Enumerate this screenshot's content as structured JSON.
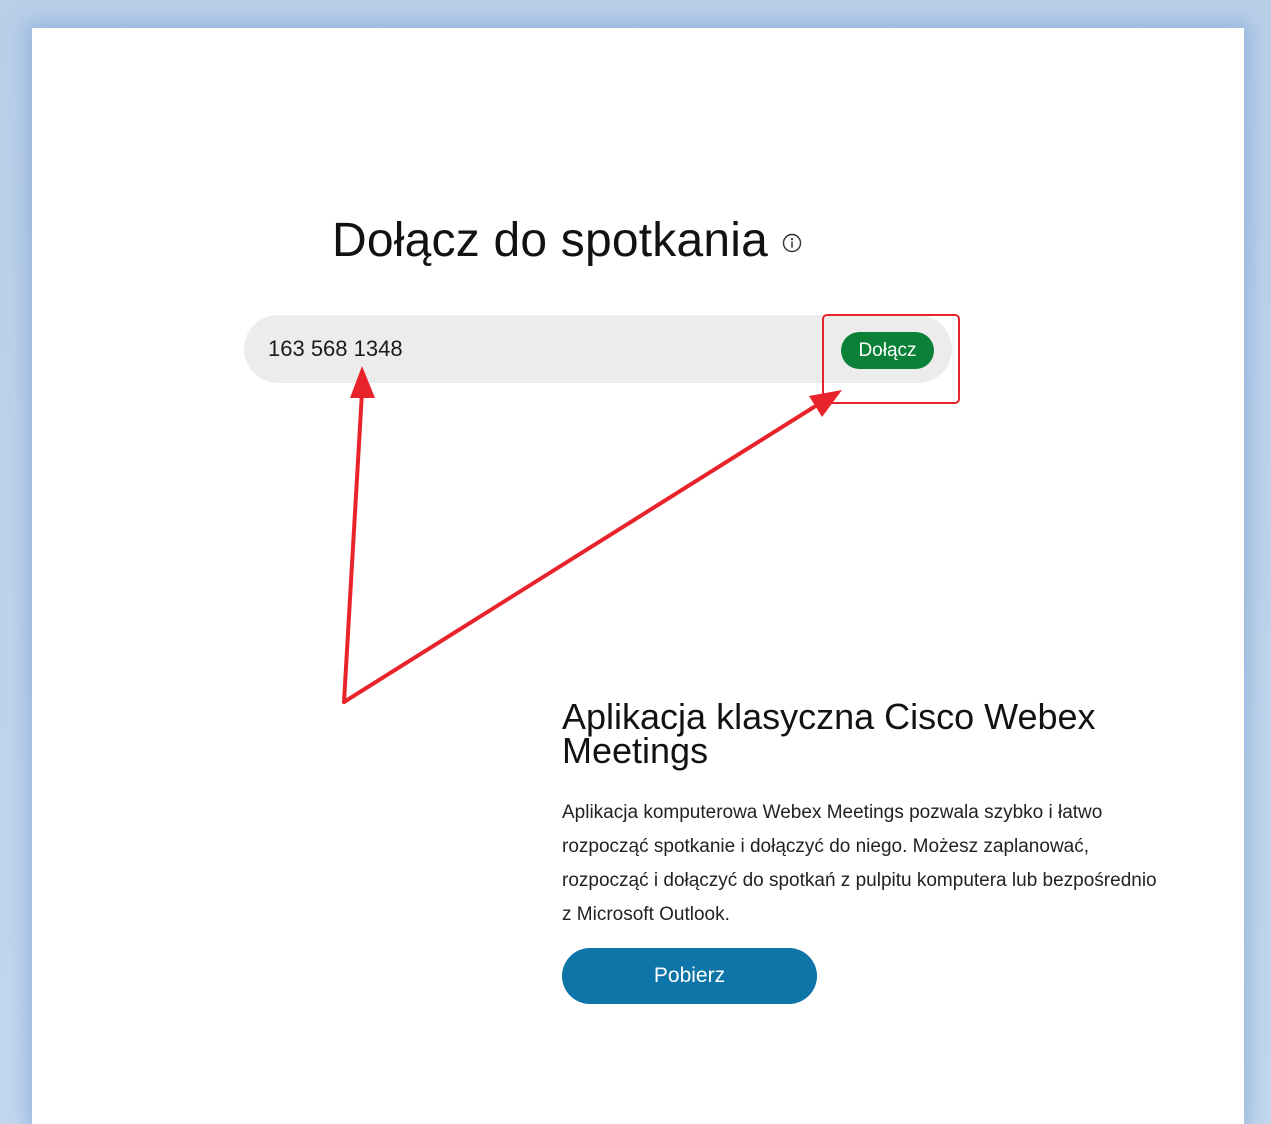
{
  "join": {
    "title": "Dołącz do spotkania",
    "meeting_number": "163 568 1348",
    "join_button_label": "Dołącz"
  },
  "desktop_app": {
    "title": "Aplikacja klasyczna Cisco Webex Meetings",
    "description": "Aplikacja komputerowa Webex Meetings pozwala szybko i łatwo rozpocząć spotkanie i dołączyć do niego. Możesz zaplanować, rozpocząć i dołączyć do spotkań z pulpitu komputera lub bezpośrednio z Microsoft Outlook.",
    "download_button_label": "Pobierz"
  },
  "icons": {
    "title_info": "info-icon"
  },
  "colors": {
    "join_button": "#0b8039",
    "download_button": "#0d75a8",
    "annotation": "#e8232b",
    "frame": "#b9cfe9"
  }
}
